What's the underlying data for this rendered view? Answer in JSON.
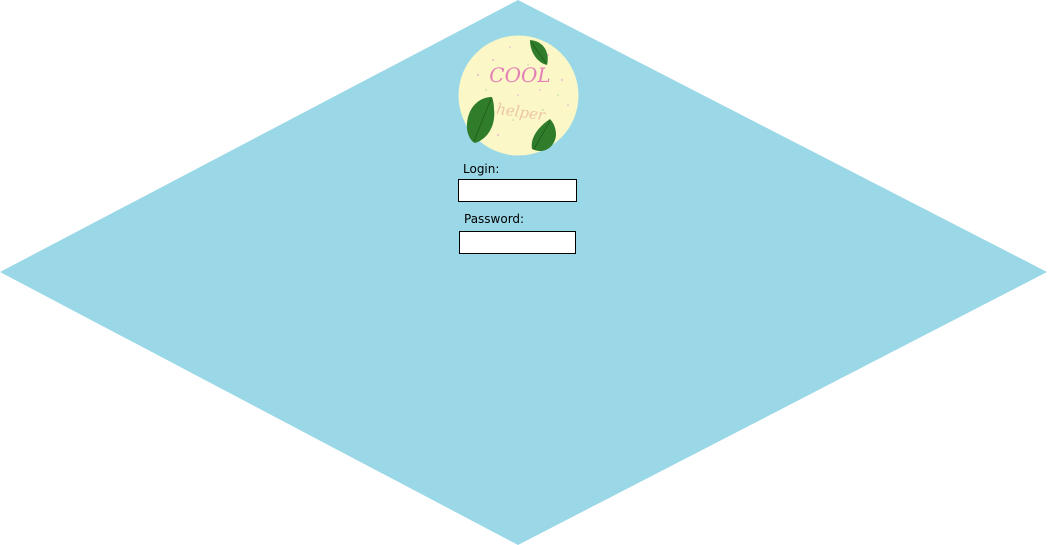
{
  "background": {
    "page_color": "#ffffff",
    "diamond_color": "#9ad8e8"
  },
  "logo": {
    "line1": "COOL",
    "line2": "helper",
    "circle_color": "#fbf7c6",
    "text_color": "#e47fb7",
    "leaf_color": "#2f7d2a"
  },
  "form": {
    "login_label": "Login:",
    "login_value": "",
    "password_label": "Password:",
    "password_value": ""
  }
}
